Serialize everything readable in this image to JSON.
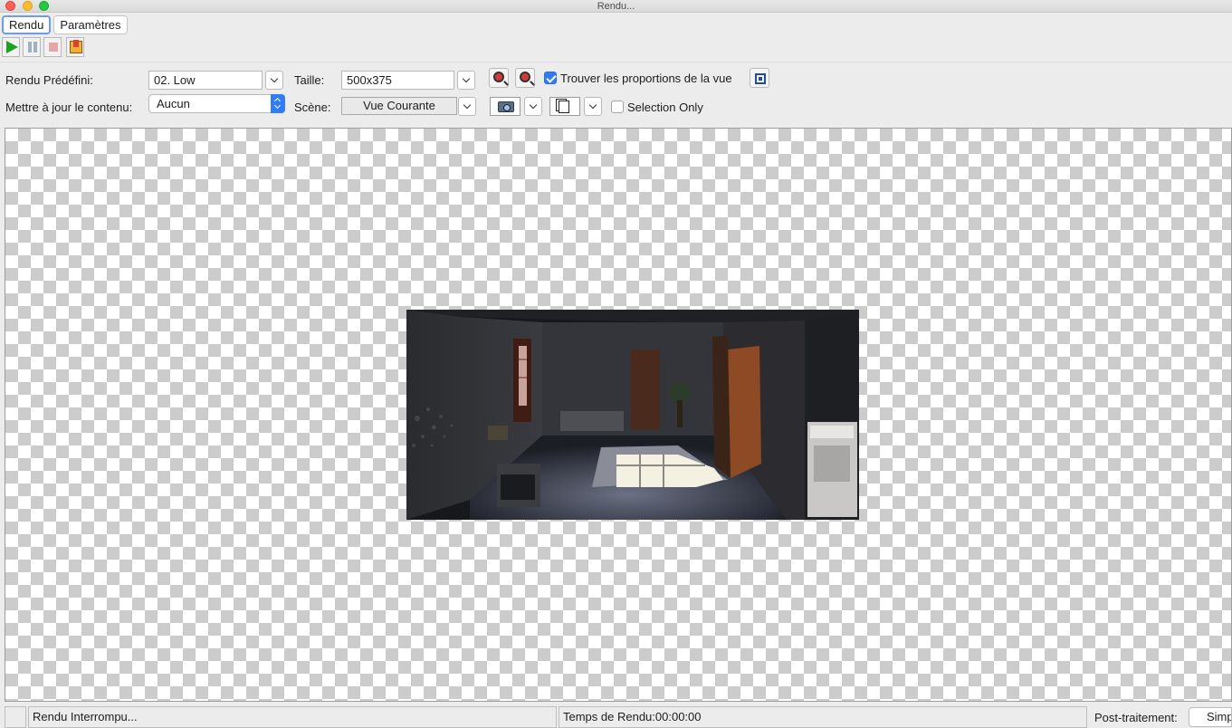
{
  "window": {
    "title": "Rendu..."
  },
  "tabs": [
    {
      "label": "Rendu",
      "active": true
    },
    {
      "label": "Paramètres",
      "active": false
    }
  ],
  "toolbar": {
    "buttons": [
      {
        "name": "play",
        "icon": "play-icon",
        "enabled": true
      },
      {
        "name": "pause",
        "icon": "pause-icon",
        "enabled": false
      },
      {
        "name": "stop",
        "icon": "stop-icon",
        "enabled": false
      },
      {
        "name": "export",
        "icon": "export-image-icon",
        "enabled": true
      }
    ]
  },
  "params": {
    "preset_label": "Rendu Prédéfini:",
    "preset_value": "02. Low",
    "size_label": "Taille:",
    "size_value": "500x375",
    "fit_label": "Trouver les proportions de la vue",
    "fit_checked": true,
    "update_label": "Mettre à jour le contenu:",
    "update_value": "Aucun",
    "scene_label": "Scène:",
    "scene_value": "Vue Courante",
    "selection_label": "Selection Only",
    "selection_checked": false
  },
  "icons": {
    "zoom_in": "zoom-in-icon",
    "zoom_out": "zoom-out-icon",
    "fit_view": "fit-view-icon",
    "camera": "camera-icon",
    "copy": "copy-icon"
  },
  "status": {
    "message": "Rendu Interrompu...",
    "render_time": "Temps de Rendu:00:00:00",
    "post_label": "Post-traitement:",
    "post_value": "Simp"
  },
  "colors": {
    "accent": "#2f7cf6",
    "play": "#19a51b"
  }
}
